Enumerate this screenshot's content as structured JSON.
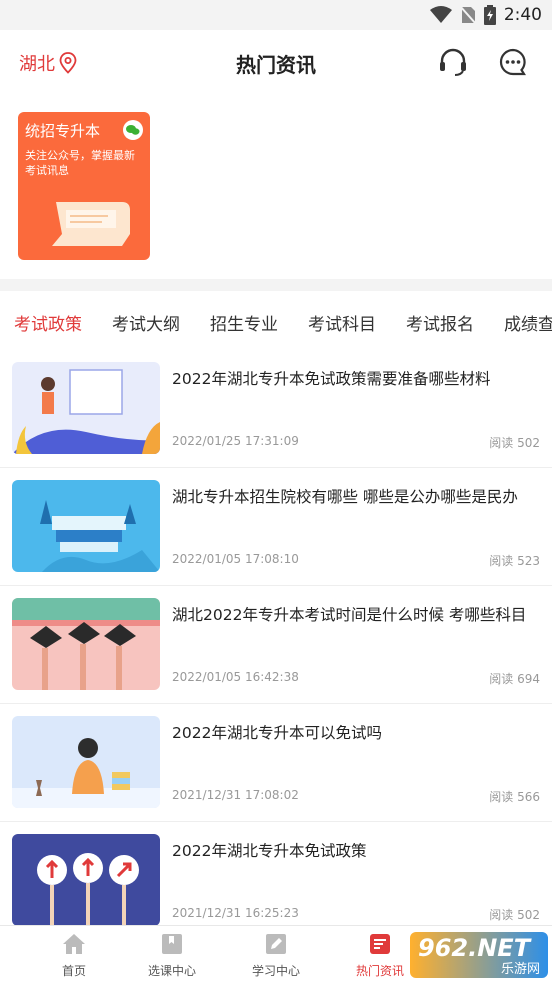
{
  "status": {
    "time": "2:40"
  },
  "header": {
    "location": "湖北",
    "title": "热门资讯"
  },
  "banner": {
    "title": "统招专升本",
    "subtitle": "关注公众号，掌握最新考试讯息"
  },
  "tabs": [
    "考试政策",
    "考试大纲",
    "招生专业",
    "考试科目",
    "考试报名",
    "成绩查"
  ],
  "articles": [
    {
      "title": "2022年湖北专升本免试政策需要准备哪些材料",
      "date": "2022/01/25 17:31:09",
      "reads": "阅读 502"
    },
    {
      "title": "湖北专升本招生院校有哪些 哪些是公办哪些是民办",
      "date": "2022/01/05 17:08:10",
      "reads": "阅读 523"
    },
    {
      "title": "湖北2022年专升本考试时间是什么时候 考哪些科目",
      "date": "2022/01/05 16:42:38",
      "reads": "阅读 694"
    },
    {
      "title": "2022年湖北专升本可以免试吗",
      "date": "2021/12/31 17:08:02",
      "reads": "阅读 566"
    },
    {
      "title": "2022年湖北专升本免试政策",
      "date": "2021/12/31 16:25:23",
      "reads": "阅读 502"
    }
  ],
  "bottom_nav": [
    "首页",
    "选课中心",
    "学习中心",
    "热门资讯"
  ],
  "watermark": {
    "big": "962.NET",
    "small": "乐游网"
  },
  "colors": {
    "accent": "#e03a3a",
    "banner": "#fb6a3c"
  }
}
